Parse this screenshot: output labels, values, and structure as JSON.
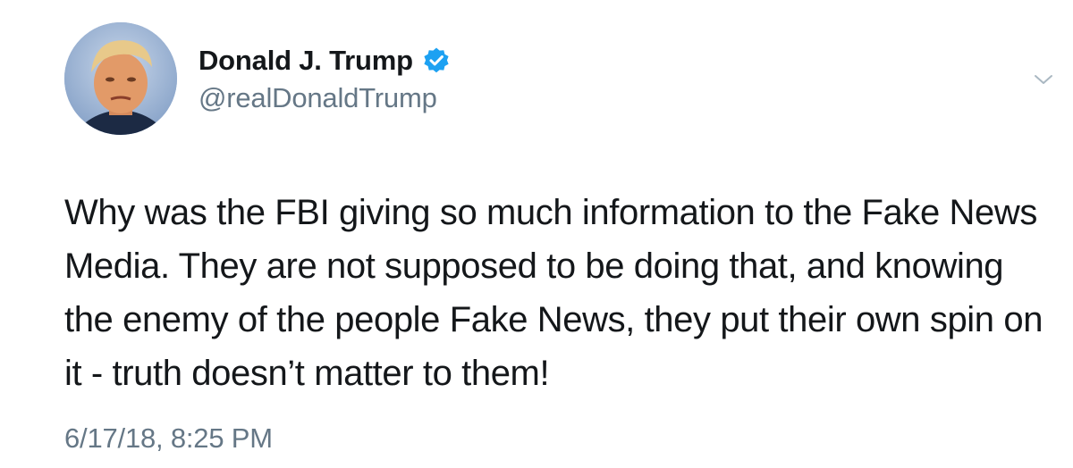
{
  "tweet": {
    "author": {
      "display_name": "Donald J. Trump",
      "handle": "@realDonaldTrump",
      "verified": true,
      "avatar_icon": "profile-photo-avatar"
    },
    "text": "Why was the FBI giving so much information to the Fake News Media. They are not supposed to be doing that, and knowing the enemy of the people Fake News, they put their own spin on it - truth doesn’t matter to them!",
    "timestamp": "6/17/18, 8:25 PM",
    "menu_icon": "chevron-down-icon"
  },
  "colors": {
    "text_primary": "#14171a",
    "text_secondary": "#657786",
    "verified_blue": "#1da1f2",
    "background": "#ffffff"
  }
}
